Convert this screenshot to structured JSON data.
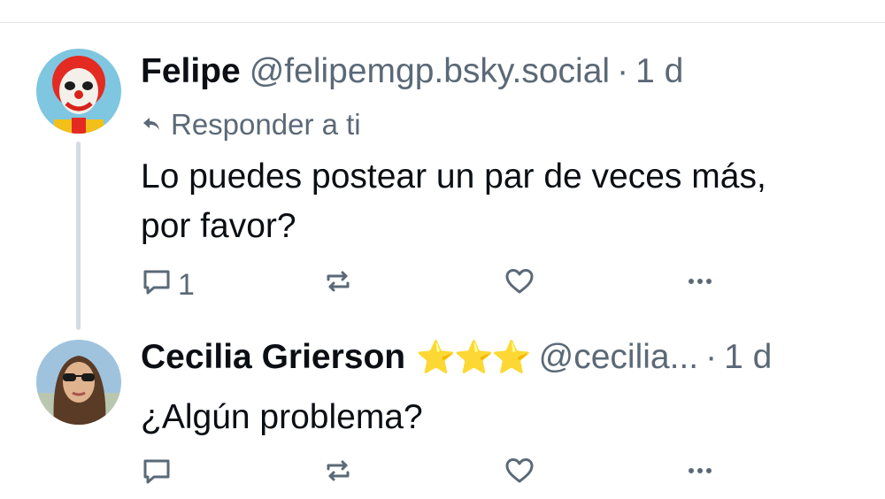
{
  "posts": [
    {
      "author_name": "Felipe",
      "handle": "@felipemgp.bsky.social",
      "separator": "·",
      "time": "1 d",
      "reply_context": "Responder a ti",
      "text": "Lo puedes postear un par de veces más, por favor?",
      "reply_count": "1"
    },
    {
      "author_name": "Cecilia Grierson",
      "name_emoji": "⭐⭐⭐",
      "handle": "@cecilia...",
      "separator": "·",
      "time": "1 d",
      "text": "¿Algún problema?"
    }
  ],
  "colors": {
    "text_primary": "#0b0f14",
    "text_secondary": "#5b6977",
    "thread_line": "#d4dbe2",
    "divider": "#e4e7eb"
  },
  "icons": [
    "reply-arrow-icon",
    "comment-icon",
    "repost-icon",
    "heart-icon",
    "more-dots-icon"
  ]
}
